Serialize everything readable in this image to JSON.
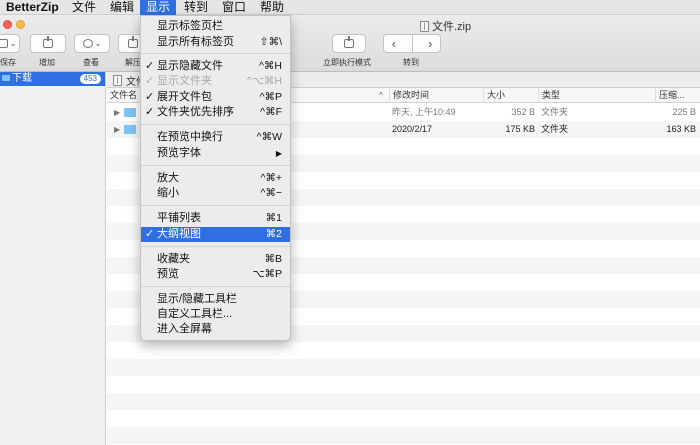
{
  "menubar": {
    "app": "BetterZip",
    "items": [
      "文件",
      "编辑",
      "显示",
      "转到",
      "窗口",
      "帮助"
    ]
  },
  "window": {
    "title": "文件.zip"
  },
  "toolbar": {
    "labels": [
      "保存",
      "增加",
      "查看",
      "解压",
      "立即执行模式",
      "转到"
    ]
  },
  "sidebar": {
    "item_label": "下载",
    "item_count": "453"
  },
  "tab": {
    "label": "文件"
  },
  "columns": {
    "name": "文件名",
    "modified": "修改时间",
    "size": "大小",
    "type": "类型",
    "compressed": "压缩..."
  },
  "rows": [
    {
      "modified": "昨天, 上午10:49",
      "size": "352 B",
      "type": "文件夹",
      "compressed": "225 B"
    },
    {
      "modified": "2020/2/17",
      "size": "175 KB",
      "type": "文件夹",
      "compressed": "163 KB"
    }
  ],
  "menu": {
    "items": [
      {
        "label": "显示标签页栏",
        "shortcut": "",
        "check": ""
      },
      {
        "label": "显示所有标签页",
        "shortcut": "⇧⌘\\",
        "check": ""
      },
      {
        "label": "显示隐藏文件",
        "shortcut": "^⌘H",
        "check": "✓"
      },
      {
        "label": "显示文件夹",
        "shortcut": "^⌥⌘H",
        "check": "✓"
      },
      {
        "label": "展开文件包",
        "shortcut": "^⌘P",
        "check": "✓"
      },
      {
        "label": "文件夹优先排序",
        "shortcut": "^⌘F",
        "check": "✓"
      },
      {
        "label": "在预览中换行",
        "shortcut": "^⌘W",
        "check": ""
      },
      {
        "label": "预览字体",
        "shortcut": "▶",
        "check": ""
      },
      {
        "label": "放大",
        "shortcut": "^⌘+",
        "check": ""
      },
      {
        "label": "缩小",
        "shortcut": "^⌘−",
        "check": ""
      },
      {
        "label": "平铺列表",
        "shortcut": "⌘1",
        "check": ""
      },
      {
        "label": "大纲视图",
        "shortcut": "⌘2",
        "check": "✓"
      },
      {
        "label": "收藏夹",
        "shortcut": "⌘B",
        "check": ""
      },
      {
        "label": "预览",
        "shortcut": "⌥⌘P",
        "check": ""
      },
      {
        "label": "显示/隐藏工具栏",
        "shortcut": "",
        "check": ""
      },
      {
        "label": "自定义工具栏...",
        "shortcut": "",
        "check": ""
      },
      {
        "label": "进入全屏幕",
        "shortcut": "",
        "check": ""
      }
    ]
  }
}
